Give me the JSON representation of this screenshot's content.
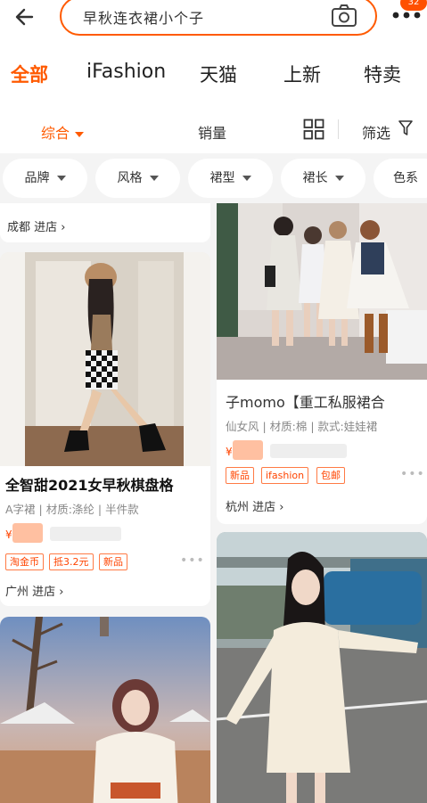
{
  "header": {
    "search_query": "早秋连衣裙小个子",
    "badge_count": "32"
  },
  "tabs": [
    "全部",
    "iFashion",
    "天猫",
    "上新",
    "特卖"
  ],
  "sortbar": {
    "sort_default": "综合",
    "sort_sales": "销量",
    "filter_label": "筛选"
  },
  "chips": [
    "品牌",
    "风格",
    "裙型",
    "裙长",
    "色系"
  ],
  "left_column": {
    "partial_store": "成都 进店",
    "product1": {
      "title": "全智甜2021女早秋棋盘格",
      "desc": "A字裙 | 材质:涤纶 | 半件款",
      "currency": "¥",
      "tags": [
        "淘金币",
        "抵3.2元",
        "新品"
      ],
      "store": "广州 进店"
    }
  },
  "right_column": {
    "product1": {
      "title": "子momo【重工私服裙合",
      "desc": "仙女风 | 材质:棉 | 款式:娃娃裙",
      "currency": "¥",
      "tags": [
        "新品",
        "ifashion",
        "包邮"
      ],
      "store": "杭州 进店"
    }
  },
  "colors": {
    "accent": "#ff5a00",
    "price": "#ff4400"
  }
}
